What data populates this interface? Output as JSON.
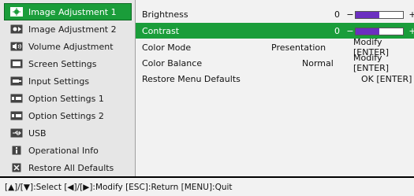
{
  "sidebar": {
    "items": [
      {
        "label": "Image Adjustment 1",
        "icon": "image-adjust-icon",
        "active": true
      },
      {
        "label": "Image Adjustment 2",
        "icon": "image-adjust-icon",
        "active": false
      },
      {
        "label": "Volume Adjustment",
        "icon": "volume-icon",
        "active": false
      },
      {
        "label": "Screen Settings",
        "icon": "screen-icon",
        "active": false
      },
      {
        "label": "Input Settings",
        "icon": "input-icon",
        "active": false
      },
      {
        "label": "Option Settings 1",
        "icon": "option-icon",
        "active": false
      },
      {
        "label": "Option Settings 2",
        "icon": "option-icon",
        "active": false
      },
      {
        "label": "USB",
        "icon": "usb-icon",
        "active": false
      },
      {
        "label": "Operational Info",
        "icon": "info-icon",
        "active": false
      },
      {
        "label": "Restore All Defaults",
        "icon": "restore-icon",
        "active": false
      }
    ]
  },
  "main": {
    "rows": [
      {
        "label": "Brightness",
        "value": "0",
        "type": "slider",
        "level": 0.5,
        "minus": "−",
        "plus": "+",
        "active": false
      },
      {
        "label": "Contrast",
        "value": "0",
        "type": "slider",
        "level": 0.5,
        "minus": "−",
        "plus": "+",
        "active": true
      },
      {
        "label": "Color Mode",
        "value": "Presentation",
        "action": "Modify [ENTER]",
        "active": false
      },
      {
        "label": "Color Balance",
        "value": "Normal",
        "action": "Modify [ENTER]",
        "active": false
      },
      {
        "label": "Restore Menu Defaults",
        "value": "",
        "action": "OK [ENTER]",
        "active": false
      }
    ]
  },
  "footer": {
    "text": "[▲]/[▼]:Select [◀]/[▶]:Modify [ESC]:Return [MENU]:Quit"
  },
  "colors": {
    "highlight": "#1a9d3a",
    "bar_fill": "#6b2fc0"
  }
}
